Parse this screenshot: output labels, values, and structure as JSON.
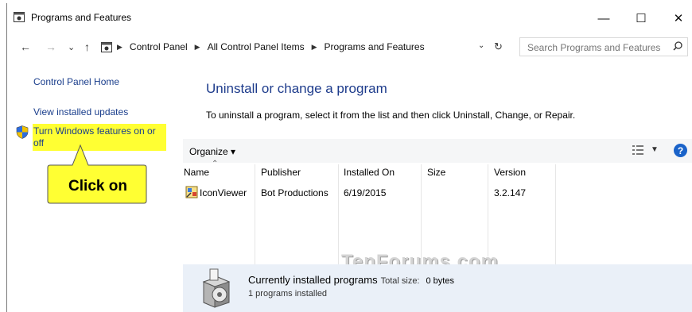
{
  "window": {
    "title": "Programs and Features",
    "minimize": "—",
    "maximize": "☐",
    "close": "✕"
  },
  "nav": {
    "back": "←",
    "forward": "→",
    "recent": "⌄",
    "up": "↑",
    "breadcrumbs": [
      "Control Panel",
      "All Control Panel Items",
      "Programs and Features"
    ],
    "refresh": "↻",
    "search_placeholder": "Search Programs and Features"
  },
  "sidebar": {
    "home": "Control Panel Home",
    "updates": "View installed updates",
    "features": "Turn Windows features on or off",
    "callout": "Click on"
  },
  "main": {
    "heading": "Uninstall or change a program",
    "subtext": "To uninstall a program, select it from the list and then click Uninstall, Change, or Repair.",
    "organize": "Organize ▾",
    "help": "?",
    "columns": [
      "Name",
      "Publisher",
      "Installed On",
      "Size",
      "Version"
    ],
    "rows": [
      {
        "name": "IconViewer",
        "publisher": "Bot Productions",
        "installed_on": "6/19/2015",
        "size": "",
        "version": "3.2.147"
      }
    ]
  },
  "watermark": "TenForums.com",
  "details": {
    "title": "Currently installed programs",
    "size_label": "Total size:",
    "size_value": "0 bytes",
    "count": "1 programs installed"
  },
  "colors": {
    "link": "#1a3e8c",
    "heading": "#1e3c8c",
    "highlight": "#ffff33",
    "toolbar": "#f5f6f7",
    "details": "#eaf0f8"
  }
}
